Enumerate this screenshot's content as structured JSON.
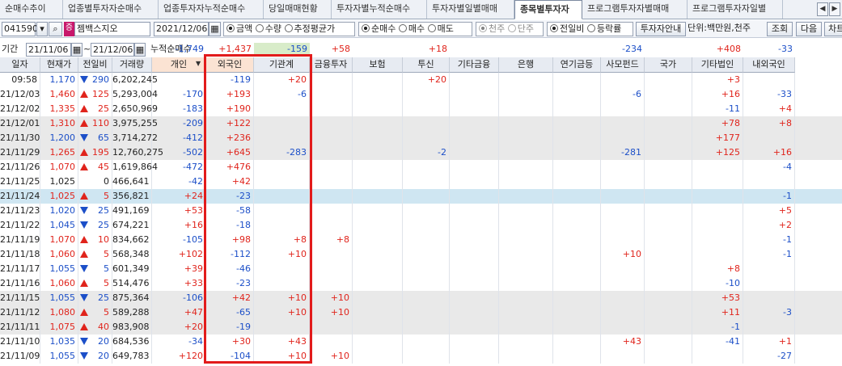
{
  "tabs": [
    {
      "label": "순매수추이",
      "w": 78
    },
    {
      "label": "업종별투자자순매수",
      "w": 118
    },
    {
      "label": "업종투자자누적순매수",
      "w": 130
    },
    {
      "label": "당일매매현황",
      "w": 84
    },
    {
      "label": "투자자별누적순매수",
      "w": 118
    },
    {
      "label": "투자자별일별매매",
      "w": 108
    },
    {
      "label": "종목별투자자",
      "w": 84
    },
    {
      "label": "프로그램투자자별매매",
      "w": 130
    },
    {
      "label": "프로그램투자자일별",
      "w": 118
    }
  ],
  "active_tab": 6,
  "toolbar": {
    "code": "041590",
    "stock_name": "젬백스지오",
    "date": "2021/12/06",
    "r_amount": "금액",
    "r_quantity": "수량",
    "r_avg": "추정평균가",
    "r_net": "순매수",
    "r_buy": "매수",
    "r_sell": "매도",
    "r_thousand": "천주",
    "r_unit": "단주",
    "r_prev": "전일비",
    "r_rate": "등락률",
    "guide_button": "투자자안내",
    "unit_text": "단위:백만원,천주",
    "query_button": "조회",
    "next_button": "다음",
    "chart_button": "차트"
  },
  "filter": {
    "period_label": "기간",
    "from": "21/11/06",
    "to": "21/12/06",
    "cum_label": "누적순매수",
    "cum_values": {
      "c5": "-1,749",
      "c6": "+1,437",
      "c7": "-159",
      "c8": "+58",
      "c10": "+18",
      "c14": "-234",
      "c16": "+408",
      "c17": "-33"
    }
  },
  "columns": [
    "일자",
    "현재가",
    "전일비",
    "거래량",
    "개인",
    "외국인",
    "기관계",
    "금융투자",
    "보험",
    "투신",
    "기타금융",
    "은행",
    "연기금등",
    "사모펀드",
    "국가",
    "기타법인",
    "내외국인"
  ],
  "rows": [
    {
      "d": "09:58",
      "p": "1,170",
      "dir": "dn",
      "c": "290",
      "v": "6,202,245",
      "ind": "",
      "for": "-119",
      "inst": "+20",
      "fin": "",
      "ins": "",
      "inv": "+20",
      "etc": "",
      "bank": "",
      "pen": "",
      "pef": "",
      "gov": "",
      "corp": "+3",
      "dom": ""
    },
    {
      "d": "21/12/03",
      "p": "1,460",
      "dir": "up",
      "c": "125",
      "v": "5,293,004",
      "ind": "-170",
      "for": "+193",
      "inst": "-6",
      "fin": "",
      "ins": "",
      "inv": "",
      "etc": "",
      "bank": "",
      "pen": "",
      "pef": "-6",
      "gov": "",
      "corp": "+16",
      "dom": "-33"
    },
    {
      "d": "21/12/02",
      "p": "1,335",
      "dir": "up",
      "c": "25",
      "v": "2,650,969",
      "ind": "-183",
      "for": "+190",
      "inst": "",
      "fin": "",
      "ins": "",
      "inv": "",
      "etc": "",
      "bank": "",
      "pen": "",
      "pef": "",
      "gov": "",
      "corp": "-11",
      "dom": "+4"
    },
    {
      "d": "21/12/01",
      "p": "1,310",
      "dir": "up",
      "c": "110",
      "v": "3,975,255",
      "ind": "-209",
      "for": "+122",
      "inst": "",
      "fin": "",
      "ins": "",
      "inv": "",
      "etc": "",
      "bank": "",
      "pen": "",
      "pef": "",
      "gov": "",
      "corp": "+78",
      "dom": "+8"
    },
    {
      "d": "21/11/30",
      "p": "1,200",
      "dir": "dn",
      "c": "65",
      "v": "3,714,272",
      "ind": "-412",
      "for": "+236",
      "inst": "",
      "fin": "",
      "ins": "",
      "inv": "",
      "etc": "",
      "bank": "",
      "pen": "",
      "pef": "",
      "gov": "",
      "corp": "+177",
      "dom": ""
    },
    {
      "d": "21/11/29",
      "p": "1,265",
      "dir": "up",
      "c": "195",
      "v": "12,760,275",
      "ind": "-502",
      "for": "+645",
      "inst": "-283",
      "fin": "",
      "ins": "",
      "inv": "-2",
      "etc": "",
      "bank": "",
      "pen": "",
      "pef": "-281",
      "gov": "",
      "corp": "+125",
      "dom": "+16"
    },
    {
      "d": "21/11/26",
      "p": "1,070",
      "dir": "up",
      "c": "45",
      "v": "1,619,864",
      "ind": "-472",
      "for": "+476",
      "inst": "",
      "fin": "",
      "ins": "",
      "inv": "",
      "etc": "",
      "bank": "",
      "pen": "",
      "pef": "",
      "gov": "",
      "corp": "",
      "dom": "-4"
    },
    {
      "d": "21/11/25",
      "p": "1,025",
      "dir": "",
      "c": "0",
      "v": "466,641",
      "ind": "-42",
      "for": "+42",
      "inst": "",
      "fin": "",
      "ins": "",
      "inv": "",
      "etc": "",
      "bank": "",
      "pen": "",
      "pef": "",
      "gov": "",
      "corp": "",
      "dom": ""
    },
    {
      "d": "21/11/24",
      "p": "1,025",
      "dir": "up",
      "c": "5",
      "v": "356,821",
      "ind": "+24",
      "for": "-23",
      "inst": "",
      "fin": "",
      "ins": "",
      "inv": "",
      "etc": "",
      "bank": "",
      "pen": "",
      "pef": "",
      "gov": "",
      "corp": "",
      "dom": "-1"
    },
    {
      "d": "21/11/23",
      "p": "1,020",
      "dir": "dn",
      "c": "25",
      "v": "491,169",
      "ind": "+53",
      "for": "-58",
      "inst": "",
      "fin": "",
      "ins": "",
      "inv": "",
      "etc": "",
      "bank": "",
      "pen": "",
      "pef": "",
      "gov": "",
      "corp": "",
      "dom": "+5"
    },
    {
      "d": "21/11/22",
      "p": "1,045",
      "dir": "dn",
      "c": "25",
      "v": "674,221",
      "ind": "+16",
      "for": "-18",
      "inst": "",
      "fin": "",
      "ins": "",
      "inv": "",
      "etc": "",
      "bank": "",
      "pen": "",
      "pef": "",
      "gov": "",
      "corp": "",
      "dom": "+2"
    },
    {
      "d": "21/11/19",
      "p": "1,070",
      "dir": "up",
      "c": "10",
      "v": "834,662",
      "ind": "-105",
      "for": "+98",
      "inst": "+8",
      "fin": "+8",
      "ins": "",
      "inv": "",
      "etc": "",
      "bank": "",
      "pen": "",
      "pef": "",
      "gov": "",
      "corp": "",
      "dom": "-1"
    },
    {
      "d": "21/11/18",
      "p": "1,060",
      "dir": "up",
      "c": "5",
      "v": "568,348",
      "ind": "+102",
      "for": "-112",
      "inst": "+10",
      "fin": "",
      "ins": "",
      "inv": "",
      "etc": "",
      "bank": "",
      "pen": "",
      "pef": "+10",
      "gov": "",
      "corp": "",
      "dom": "-1"
    },
    {
      "d": "21/11/17",
      "p": "1,055",
      "dir": "dn",
      "c": "5",
      "v": "601,349",
      "ind": "+39",
      "for": "-46",
      "inst": "",
      "fin": "",
      "ins": "",
      "inv": "",
      "etc": "",
      "bank": "",
      "pen": "",
      "pef": "",
      "gov": "",
      "corp": "+8",
      "dom": ""
    },
    {
      "d": "21/11/16",
      "p": "1,060",
      "dir": "up",
      "c": "5",
      "v": "514,476",
      "ind": "+33",
      "for": "-23",
      "inst": "",
      "fin": "",
      "ins": "",
      "inv": "",
      "etc": "",
      "bank": "",
      "pen": "",
      "pef": "",
      "gov": "",
      "corp": "-10",
      "dom": ""
    },
    {
      "d": "21/11/15",
      "p": "1,055",
      "dir": "dn",
      "c": "25",
      "v": "875,364",
      "ind": "-106",
      "for": "+42",
      "inst": "+10",
      "fin": "+10",
      "ins": "",
      "inv": "",
      "etc": "",
      "bank": "",
      "pen": "",
      "pef": "",
      "gov": "",
      "corp": "+53",
      "dom": ""
    },
    {
      "d": "21/11/12",
      "p": "1,080",
      "dir": "up",
      "c": "5",
      "v": "589,288",
      "ind": "+47",
      "for": "-65",
      "inst": "+10",
      "fin": "+10",
      "ins": "",
      "inv": "",
      "etc": "",
      "bank": "",
      "pen": "",
      "pef": "",
      "gov": "",
      "corp": "+11",
      "dom": "-3"
    },
    {
      "d": "21/11/11",
      "p": "1,075",
      "dir": "up",
      "c": "40",
      "v": "983,908",
      "ind": "+20",
      "for": "-19",
      "inst": "",
      "fin": "",
      "ins": "",
      "inv": "",
      "etc": "",
      "bank": "",
      "pen": "",
      "pef": "",
      "gov": "",
      "corp": "-1",
      "dom": ""
    },
    {
      "d": "21/11/10",
      "p": "1,035",
      "dir": "dn",
      "c": "20",
      "v": "684,536",
      "ind": "-34",
      "for": "+30",
      "inst": "+43",
      "fin": "",
      "ins": "",
      "inv": "",
      "etc": "",
      "bank": "",
      "pen": "",
      "pef": "+43",
      "gov": "",
      "corp": "-41",
      "dom": "+1"
    },
    {
      "d": "21/11/09",
      "p": "1,055",
      "dir": "dn",
      "c": "20",
      "v": "649,783",
      "ind": "+120",
      "for": "-104",
      "inst": "+10",
      "fin": "+10",
      "ins": "",
      "inv": "",
      "etc": "",
      "bank": "",
      "pen": "",
      "pef": "",
      "gov": "",
      "corp": "",
      "dom": "-27"
    }
  ],
  "colors": {
    "up": "#e0241c",
    "down": "#1c4fc8",
    "highlight": "#e21b1b"
  }
}
